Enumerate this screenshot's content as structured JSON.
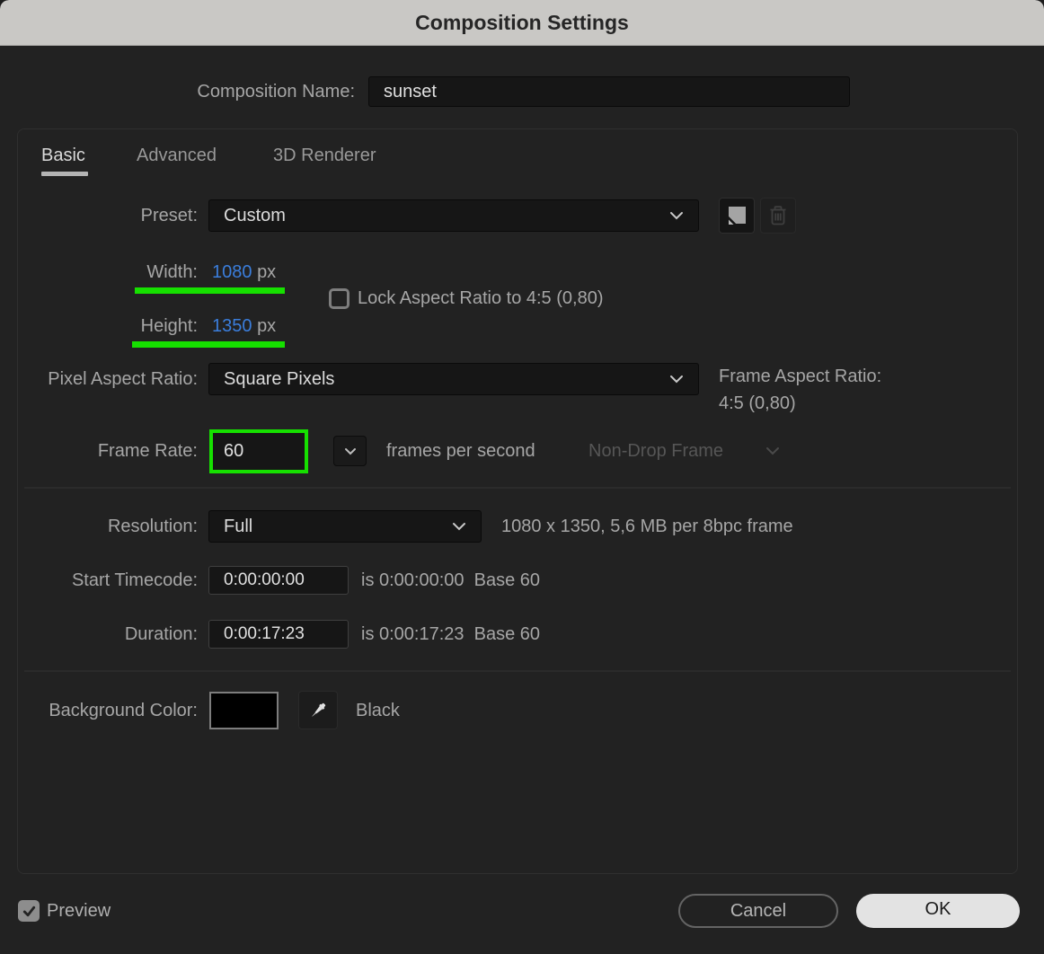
{
  "window": {
    "title": "Composition Settings"
  },
  "name_row": {
    "label": "Composition Name:",
    "value": "sunset"
  },
  "tabs": [
    {
      "label": "Basic",
      "active": true
    },
    {
      "label": "Advanced",
      "active": false
    },
    {
      "label": "3D Renderer",
      "active": false
    }
  ],
  "preset": {
    "label": "Preset:",
    "value": "Custom"
  },
  "dimensions": {
    "width_label": "Width:",
    "width_value": "1080",
    "width_unit": "px",
    "height_label": "Height:",
    "height_value": "1350",
    "height_unit": "px",
    "lock_label": "Lock Aspect Ratio to 4:5 (0,80)",
    "lock_checked": false,
    "value_color": "#3b7edc"
  },
  "pixel_aspect": {
    "label": "Pixel Aspect Ratio:",
    "value": "Square Pixels",
    "frame_aspect_label": "Frame Aspect Ratio:",
    "frame_aspect_value": "4:5 (0,80)"
  },
  "frame_rate": {
    "label": "Frame Rate:",
    "value": "60",
    "unit": "frames per second",
    "drop_frame": "Non-Drop Frame"
  },
  "resolution": {
    "label": "Resolution:",
    "value": "Full",
    "info": "1080 x 1350, 5,6 MB per 8bpc frame"
  },
  "start_timecode": {
    "label": "Start Timecode:",
    "value": "0:00:00:00",
    "info": "is 0:00:00:00  Base 60"
  },
  "duration": {
    "label": "Duration:",
    "value": "0:00:17:23",
    "info": "is 0:00:17:23  Base 60"
  },
  "background_color": {
    "label": "Background Color:",
    "value_name": "Black",
    "swatch_color": "#000000"
  },
  "footer": {
    "preview_label": "Preview",
    "preview_checked": true,
    "cancel_label": "Cancel",
    "ok_label": "OK"
  },
  "annotations": {
    "highlight_color": "#16e000"
  }
}
